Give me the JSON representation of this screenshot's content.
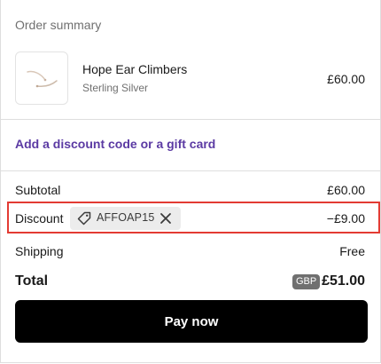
{
  "summary": {
    "title": "Order summary"
  },
  "product": {
    "name": "Hope Ear Climbers",
    "variant": "Sterling Silver",
    "price": "£60.00",
    "image_icon": "earring-product-icon"
  },
  "discount_link": {
    "label": "Add a discount code or a gift card"
  },
  "rows": {
    "subtotal_label": "Subtotal",
    "subtotal_value": "£60.00",
    "discount_label": "Discount",
    "discount_code": "AFFOAP15",
    "discount_value": "−£9.00",
    "shipping_label": "Shipping",
    "shipping_value": "Free"
  },
  "total": {
    "label": "Total",
    "currency": "GBP",
    "value": "£51.00"
  },
  "pay_button": {
    "label": "Pay now"
  },
  "colors": {
    "link": "#5b3aa3",
    "highlight_border": "#e33b33",
    "button_bg": "#000000",
    "chip_bg": "#ececec",
    "badge_bg": "#707070"
  }
}
